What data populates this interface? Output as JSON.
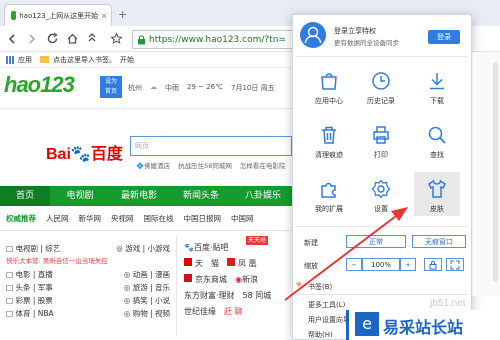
{
  "browser": {
    "tab_title": "hao123_上网从这里开始",
    "new_tab_glyph": "+",
    "url": "https://www.hao123.com/?tn=",
    "bookmarks_label": "应用",
    "bookmarks_hint": "点击这里导入书签。",
    "bookmarks_start": "开始"
  },
  "page": {
    "logo": "hao123",
    "badge_line1": "设为",
    "badge_line2": "首页",
    "city": "杭州",
    "weather": "中雨",
    "temperature": "29 ~ 26℃",
    "date": "7月10日 周五",
    "search_tab": "网页",
    "search_hints": [
      "💠佛媛酒店",
      "抗战压住58同城网",
      "怎样看在电影院"
    ],
    "nav": [
      "首页",
      "电视剧",
      "最新电影",
      "新闻头条",
      "八卦娱乐"
    ],
    "subnav": [
      "权威推荐",
      "人民网",
      "新华网",
      "央视网",
      "国际在线",
      "中国日报网",
      "中国网"
    ],
    "left_links": [
      [
        "电视剧",
        "综艺",
        "游戏",
        "小游戏"
      ],
      [
        "电影",
        "直播",
        "动画",
        "漫画"
      ],
      [
        "头条",
        "军事",
        "旅游",
        "音乐"
      ],
      [
        "彩票",
        "股票",
        "搞笑",
        "小说"
      ],
      [
        "体育",
        "NBA",
        "购物",
        "视频"
      ]
    ],
    "notice": "快乐大本营: 吴昕自信一山当场失控",
    "mid_links": [
      [
        "百度·贴吧"
      ],
      [
        "天",
        "猫",
        "凤",
        "凰"
      ],
      [
        "京东商城",
        "新浪"
      ],
      [
        "东方财富·理财",
        "58 同城"
      ],
      [
        "世纪佳缘",
        "赶 聊"
      ]
    ],
    "hot_badge": "天天抢",
    "baidu_word": "百度"
  },
  "menu": {
    "login_title": "登录立享特权",
    "login_sub": "更有数据的全设备同步",
    "login_button": "登录",
    "items": [
      {
        "label": "应用中心",
        "icon": "app-center-icon"
      },
      {
        "label": "历史记录",
        "icon": "history-icon"
      },
      {
        "label": "下载",
        "icon": "download-icon"
      },
      {
        "label": "清理痕迹",
        "icon": "trash-icon"
      },
      {
        "label": "打印",
        "icon": "printer-icon"
      },
      {
        "label": "查找",
        "icon": "search-icon"
      },
      {
        "label": "我的扩展",
        "icon": "puzzle-icon"
      },
      {
        "label": "设置",
        "icon": "gear-icon"
      },
      {
        "label": "皮肤",
        "icon": "skin-shirt-icon"
      }
    ],
    "new_label": "新建",
    "new_normal": "正常",
    "new_incognito": "无痕窗口",
    "zoom_label": "缩放",
    "zoom_minus": "−",
    "zoom_value": "100%",
    "zoom_plus": "+",
    "bookmarks_label": "书签(B)",
    "more_tools": "更多工具(L)",
    "user_guide": "用户设置向导(W)",
    "help": "帮助(H)"
  },
  "watermark": {
    "domain": "jb51.net",
    "site": "易采站长站"
  },
  "colors": {
    "accent_blue": "#2f7de1",
    "nav_green": "#169b2e",
    "hao_green": "#2aa52a",
    "hao_orange": "#ff7a00",
    "baidu_red": "#e10602",
    "baidu_blue": "#2932e1",
    "arrow_red": "#e53935"
  }
}
